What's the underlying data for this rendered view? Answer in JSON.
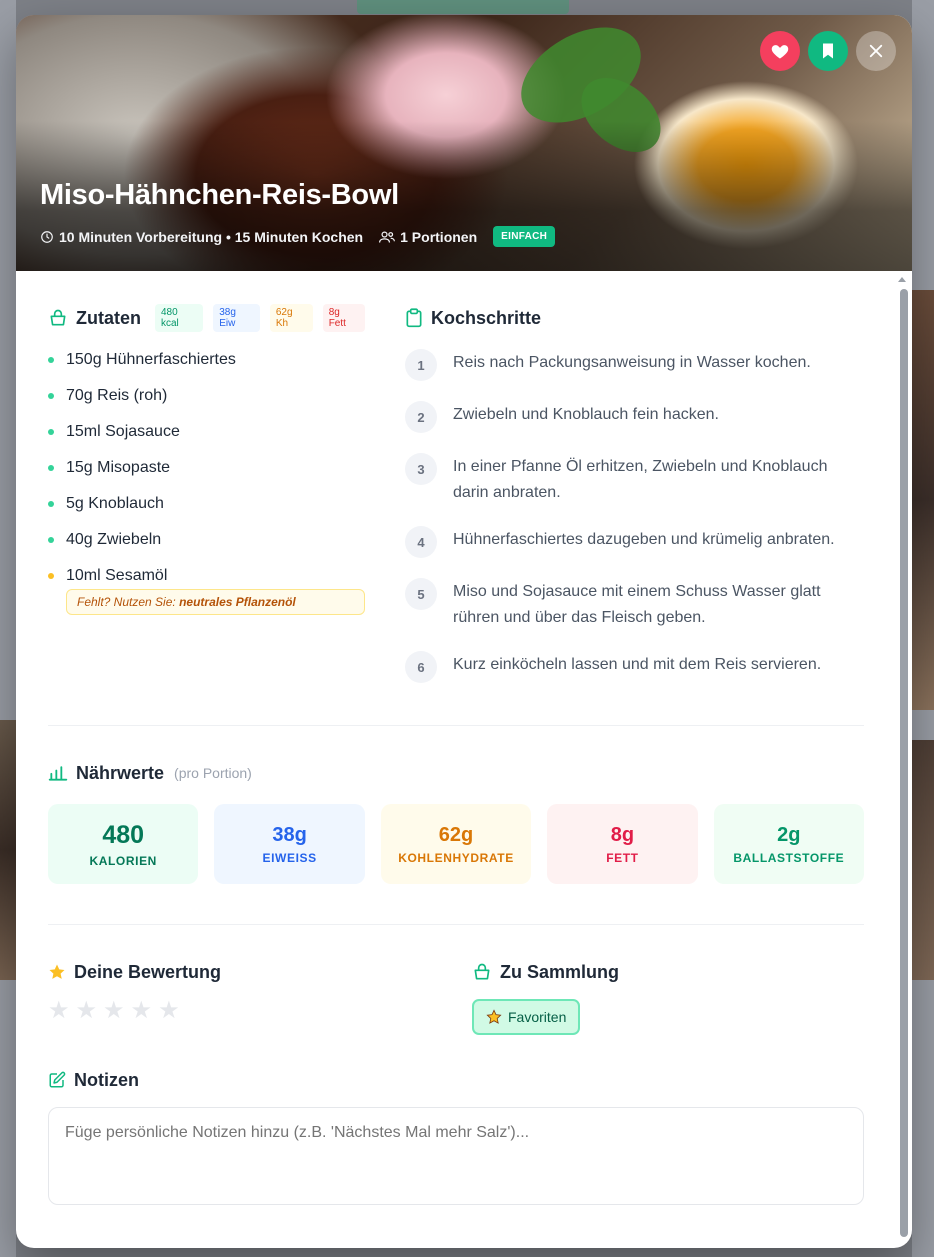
{
  "recipe": {
    "title": "Miso-Hähnchen-Reis-Bowl",
    "prep": "10 Minuten Vorbereitung • 15 Minuten Kochen",
    "portions": "1 Portionen",
    "difficulty": "EINFACH"
  },
  "ingredients_section": {
    "title": "Zutaten",
    "chips": {
      "kcal": "480 kcal",
      "protein": "38g Eiw",
      "carbs": "62g Kh",
      "fat": "8g Fett"
    },
    "items": [
      "150g Hühnerfaschiertes",
      "70g Reis (roh)",
      "15ml Sojasauce",
      "15g Misopaste",
      "5g Knoblauch",
      "40g Zwiebeln",
      "10ml Sesamöl"
    ],
    "substitute_prefix": "Fehlt? Nutzen Sie:",
    "substitute_value": "neutrales Pflanzenöl"
  },
  "steps_section": {
    "title": "Kochschritte",
    "steps": [
      {
        "num": "1",
        "text": "Reis nach Packungsanweisung in Wasser kochen."
      },
      {
        "num": "2",
        "text": "Zwiebeln und Knoblauch fein hacken."
      },
      {
        "num": "3",
        "text": "In einer Pfanne Öl erhitzen, Zwiebeln und Knoblauch darin anbraten."
      },
      {
        "num": "4",
        "text": "Hühnerfaschiertes dazugeben und krümelig anbraten."
      },
      {
        "num": "5",
        "text": "Miso und Sojasauce mit einem Schuss Wasser glatt rühren und über das Fleisch geben."
      },
      {
        "num": "6",
        "text": "Kurz einköcheln lassen und mit dem Reis servieren."
      }
    ]
  },
  "nutrition": {
    "title": "Nährwerte",
    "subtitle": "(pro Portion)",
    "cards": [
      {
        "value": "480",
        "label": "KALORIEN"
      },
      {
        "value": "38g",
        "label": "EIWEISS"
      },
      {
        "value": "62g",
        "label": "KOHLENHYDRATE"
      },
      {
        "value": "8g",
        "label": "FETT"
      },
      {
        "value": "2g",
        "label": "BALLASTSTOFFE"
      }
    ]
  },
  "rating": {
    "title": "Deine Bewertung",
    "stars": 0,
    "max": 5
  },
  "collection": {
    "title": "Zu Sammlung",
    "button": "Favoriten"
  },
  "notes": {
    "title": "Notizen",
    "placeholder": "Füge persönliche Notizen hinzu (z.B. 'Nächstes Mal mehr Salz')..."
  },
  "colors": {
    "accent": "#10b981",
    "heart": "#f43f5e",
    "star": "#fbbf24"
  }
}
